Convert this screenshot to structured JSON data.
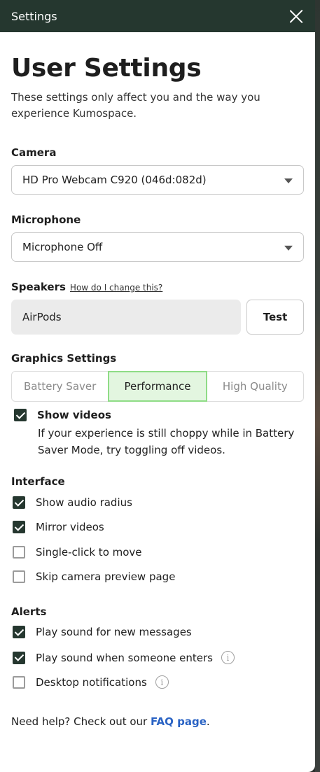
{
  "window": {
    "title": "Settings"
  },
  "header": {
    "title": "User Settings",
    "subtitle": "These settings only affect you and the way you experience Kumospace."
  },
  "camera": {
    "label": "Camera",
    "selected": "HD Pro Webcam C920 (046d:082d)"
  },
  "microphone": {
    "label": "Microphone",
    "selected": "Microphone Off"
  },
  "speakers": {
    "label": "Speakers",
    "help_link": "How do I change this?",
    "value": "AirPods",
    "test_label": "Test"
  },
  "graphics": {
    "label": "Graphics Settings",
    "options": [
      "Battery Saver",
      "Performance",
      "High Quality"
    ],
    "selected": "Performance",
    "show_videos": {
      "label": "Show videos",
      "checked": true,
      "description": "If your experience is still choppy while in Battery Saver Mode, try toggling off videos."
    }
  },
  "interface": {
    "label": "Interface",
    "items": [
      {
        "label": "Show audio radius",
        "checked": true
      },
      {
        "label": "Mirror videos",
        "checked": true
      },
      {
        "label": "Single-click to move",
        "checked": false
      },
      {
        "label": "Skip camera preview page",
        "checked": false
      }
    ]
  },
  "alerts": {
    "label": "Alerts",
    "items": [
      {
        "label": "Play sound for new messages",
        "checked": true,
        "info": false
      },
      {
        "label": "Play sound when someone enters",
        "checked": true,
        "info": true
      },
      {
        "label": "Desktop notifications",
        "checked": false,
        "info": true
      }
    ]
  },
  "footer": {
    "text": "Need help? Check out our ",
    "link": "FAQ page",
    "end": "."
  },
  "icons": {
    "close": "close-icon",
    "caret": "chevron-down-icon",
    "check": "checkmark-icon",
    "info": "info-icon"
  }
}
